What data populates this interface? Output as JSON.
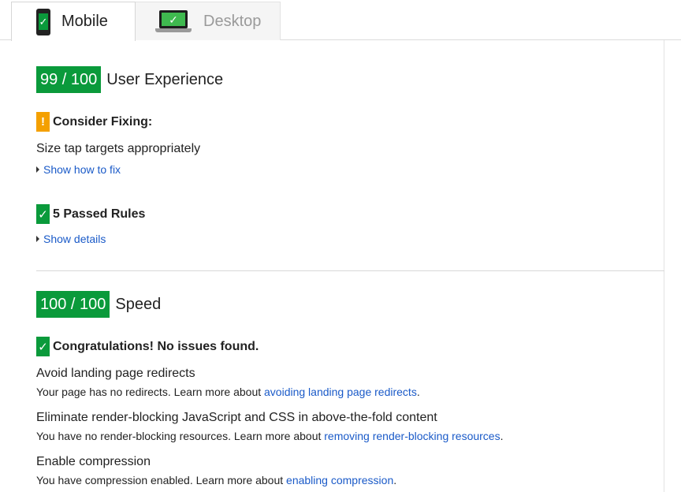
{
  "tabs": [
    {
      "label": "Mobile",
      "icon": "phone-icon",
      "active": true
    },
    {
      "label": "Desktop",
      "icon": "laptop-icon",
      "active": false
    }
  ],
  "user_experience": {
    "score": "99 / 100",
    "title": "User Experience",
    "consider": {
      "icon": "warning-icon",
      "glyph": "!",
      "heading": "Consider Fixing:"
    },
    "rule": "Size tap targets appropriately",
    "show_fix": "Show how to fix",
    "passed": {
      "icon": "check-icon",
      "glyph": "✓",
      "heading": "5 Passed Rules"
    },
    "show_details": "Show details"
  },
  "speed": {
    "score": "100 / 100",
    "title": "Speed",
    "congrats": {
      "icon": "check-icon",
      "glyph": "✓",
      "heading": "Congratulations! No issues found."
    },
    "items": [
      {
        "title": "Avoid landing page redirects",
        "text": "Your page has no redirects. Learn more about ",
        "link": "avoiding landing page redirects",
        "end": "."
      },
      {
        "title": "Eliminate render-blocking JavaScript and CSS in above-the-fold content",
        "text": "You have no render-blocking resources. Learn more about ",
        "link": "removing render-blocking resources",
        "end": "."
      },
      {
        "title": "Enable compression",
        "text": "You have compression enabled. Learn more about ",
        "link": "enabling compression",
        "end": "."
      }
    ]
  },
  "colors": {
    "score_green": "#0a9a3b",
    "warn_orange": "#f4a000",
    "link_blue": "#1a5ac8"
  }
}
